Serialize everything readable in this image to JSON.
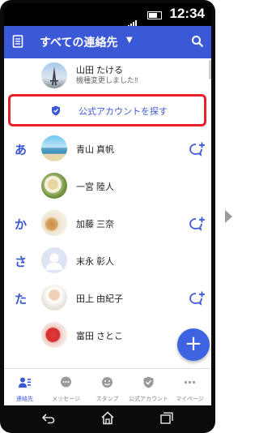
{
  "status": {
    "time": "12:34"
  },
  "appbar": {
    "title": "すべての連絡先",
    "caret": "▼"
  },
  "pinned": {
    "name": "山田 たける",
    "status": "機種変更しました‼"
  },
  "official": {
    "label": "公式アカウントを探す"
  },
  "contacts": [
    {
      "index": "あ",
      "name": "青山 真帆"
    },
    {
      "index": "",
      "name": "一宮 陸人"
    },
    {
      "index": "か",
      "name": "加藤 三奈"
    },
    {
      "index": "さ",
      "name": "末永 彰人"
    },
    {
      "index": "た",
      "name": "田上 由紀子"
    },
    {
      "index": "",
      "name": "富田 さとこ"
    }
  ],
  "fab": {
    "symbol": "+"
  },
  "tabs": [
    {
      "label": "連絡先"
    },
    {
      "label": "メッセージ"
    },
    {
      "label": "スタンプ"
    },
    {
      "label": "公式アカウント"
    },
    {
      "label": "マイページ"
    }
  ],
  "colors": {
    "accent": "#3b58d6",
    "highlight": "#e8202a"
  }
}
